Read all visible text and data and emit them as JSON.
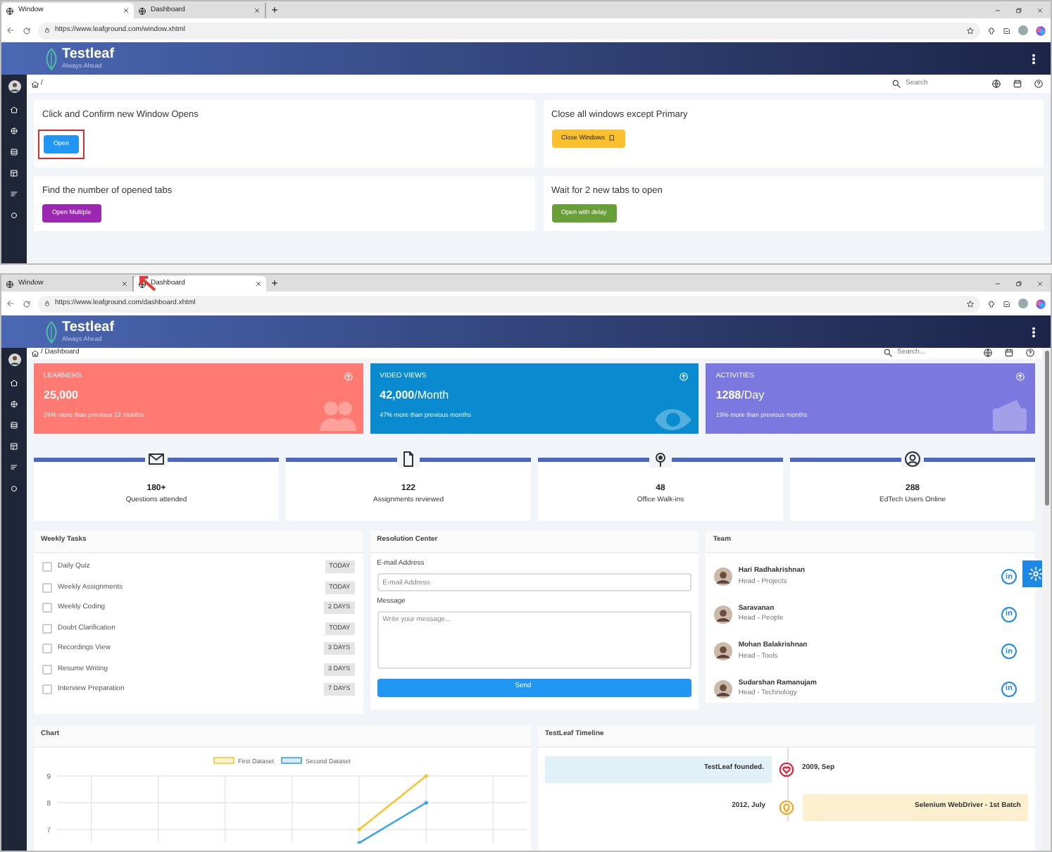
{
  "windows": [
    {
      "tabs": [
        {
          "label": "Window",
          "selected": true
        },
        {
          "label": "Dashboard",
          "selected": false
        }
      ],
      "url": "https://www.leafground.com/window.xhtml",
      "logo": "Testleaf",
      "tagline": "Always Ahead",
      "breadcrumb": "/",
      "search_placeholder": "Search",
      "panels": [
        {
          "title": "Click and Confirm new Window Opens",
          "button": {
            "label": "Open",
            "color": "#2196f3",
            "highlighted": true,
            "icon": false
          }
        },
        {
          "title": "Close all windows except Primary",
          "button": {
            "label": "Close Windows",
            "color": "#fbc02d",
            "highlighted": false,
            "icon": true
          }
        },
        {
          "title": "Find the number of opened tabs",
          "button": {
            "label": "Open Multiple",
            "color": "#9c27b0",
            "highlighted": false,
            "icon": false
          }
        },
        {
          "title": "Wait for 2 new tabs to open",
          "button": {
            "label": "Open with delay",
            "color": "#689f38",
            "highlighted": false,
            "icon": false
          }
        }
      ]
    },
    {
      "tabs": [
        {
          "label": "Window",
          "selected": false
        },
        {
          "label": "Dashboard",
          "selected": true
        }
      ],
      "url": "https://www.leafground.com/dashboard.xhtml",
      "logo": "Testleaf",
      "tagline": "Always Ahead",
      "breadcrumb": "/ Dashboard",
      "search_placeholder": "Search...",
      "highlights": [
        {
          "title": "LEARNERS",
          "value": "**25,000**",
          "note": "24% more than previous 12 months",
          "color": "#ff7a72",
          "kind": "people"
        },
        {
          "title": "VIDEO VIEWS",
          "value": "**42,000**/Month",
          "note": "47% more than previous months",
          "color": "#0a8bd0",
          "kind": "eye"
        },
        {
          "title": "ACTIVITIES",
          "value": "**1288**/Day",
          "note": "19% more than previous months",
          "color": "#7b78e0",
          "kind": "wallet"
        }
      ],
      "stats": [
        {
          "value": "180+",
          "label": "Questions attended",
          "kind": "mail"
        },
        {
          "value": "122",
          "label": "Assignments reviewed",
          "kind": "document"
        },
        {
          "value": "48",
          "label": "Office Walk-ins",
          "kind": "pin"
        },
        {
          "value": "288",
          "label": "EdTech Users Online",
          "kind": "user"
        }
      ],
      "weekly_tasks": {
        "title": "Weekly Tasks",
        "items": [
          {
            "label": "Daily Quiz",
            "due": "TODAY",
            "checked": false
          },
          {
            "label": "Weekly Assignments",
            "due": "TODAY",
            "checked": false
          },
          {
            "label": "Weekly Coding",
            "due": "2 DAYS",
            "checked": false
          },
          {
            "label": "Doubt Clarification",
            "due": "TODAY",
            "checked": false
          },
          {
            "label": "Recordings View",
            "due": "3 DAYS",
            "checked": false
          },
          {
            "label": "Resume Writing",
            "due": "3 DAYS",
            "checked": false
          },
          {
            "label": "Interview Preparation",
            "due": "7 DAYS",
            "checked": false
          }
        ]
      },
      "resolution_center": {
        "title": "Resolution Center",
        "email_label": "E-mail Address",
        "email_placeholder": "E-mail Address",
        "message_label": "Message",
        "message_placeholder": "Write your message...",
        "button": "Send"
      },
      "team": {
        "title": "Team",
        "members": [
          {
            "name": "Hari Radhakrishnan",
            "role": "Head - Projects",
            "link": "in"
          },
          {
            "name": "Saravanan",
            "role": "Head - People",
            "link": "in"
          },
          {
            "name": "Mohan Balakrishnan",
            "role": "Head - Tools",
            "link": "in"
          },
          {
            "name": "Sudarshan Ramanujam",
            "role": "Head - Technology",
            "link": "in"
          }
        ]
      },
      "chart": {
        "title": "Chart",
        "chart_data": {
          "type": "line",
          "categories": [
            null,
            null,
            null,
            null,
            null,
            null,
            null
          ],
          "ylim": [
            6.5,
            9
          ],
          "yticks": [
            7,
            8,
            9
          ],
          "legend": "top",
          "grid": true,
          "series": [
            {
              "name": "First Dataset",
              "color": "#f5c431",
              "values": [
                null,
                null,
                null,
                null,
                7,
                9,
                null
              ]
            },
            {
              "name": "Second Dataset",
              "color": "#36a2eb",
              "values": [
                null,
                null,
                null,
                null,
                6.5,
                8,
                null
              ]
            }
          ]
        }
      },
      "timeline": {
        "title": "TestLeaf Timeline",
        "events": [
          {
            "text": "TestLeaf founded.",
            "date": "2009, Sep",
            "kind": "left",
            "color": "#e0243a"
          },
          {
            "text": "Selenium WebDriver - 1st Batch",
            "date": "2012, July",
            "kind": "right",
            "color": "#f5a623"
          }
        ]
      }
    }
  ]
}
